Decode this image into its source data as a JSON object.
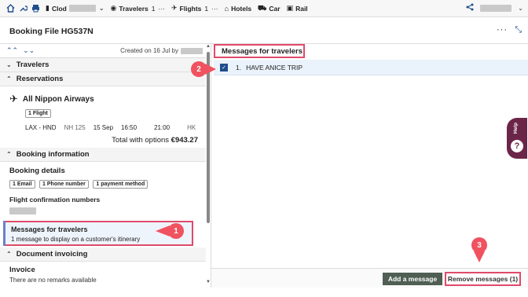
{
  "toolbar": {
    "items": [
      {
        "label": "Clod",
        "icon": "file-icon"
      },
      {
        "label": "Travelers",
        "count": "1",
        "icon": "user-icon"
      },
      {
        "label": "Flights",
        "count": "1",
        "icon": "plane-icon"
      },
      {
        "label": "Hotels",
        "icon": "hotel-icon"
      },
      {
        "label": "Car",
        "icon": "car-icon"
      },
      {
        "label": "Rail",
        "icon": "train-icon"
      }
    ],
    "more": "···"
  },
  "header": {
    "title": "Booking File HG537N",
    "more": "···"
  },
  "left": {
    "created_label": "Created on 16 Jul by",
    "sections": {
      "travelers": "Travelers",
      "reservations": "Reservations",
      "booking_information": "Booking information",
      "document_invoicing": "Document invoicing"
    },
    "flight": {
      "airline": "All Nippon Airways",
      "chip": "1 Flight",
      "route": "LAX - HND",
      "flight_no": "NH 125",
      "date": "15 Sep",
      "dep": "16:50",
      "arr": "21:00",
      "dest": "HK",
      "total_label": "Total with options",
      "total_value": "€943.27"
    },
    "booking_details": {
      "title": "Booking details",
      "chips": [
        "1 Email",
        "1 Phone number",
        "1 payment method"
      ]
    },
    "flight_confirmation": "Flight confirmation numbers",
    "messages_card": {
      "title": "Messages for travelers",
      "subtitle": "1 message to display on a customer's itinerary"
    },
    "invoice": {
      "title": "Invoice",
      "subtitle": "There are no remarks available"
    }
  },
  "right": {
    "title": "Messages for travelers",
    "messages": [
      {
        "num": "1.",
        "text": "HAVE ANICE TRIP",
        "checked": true
      }
    ],
    "add_button": "Add a message",
    "remove_button": "Remove messages (1)"
  },
  "callouts": [
    "1",
    "2",
    "3"
  ],
  "help_label": "Help",
  "colors": {
    "accent": "#1f4e8c",
    "highlight": "#e04a6b",
    "callout": "#f0525f",
    "help": "#6b2548"
  }
}
